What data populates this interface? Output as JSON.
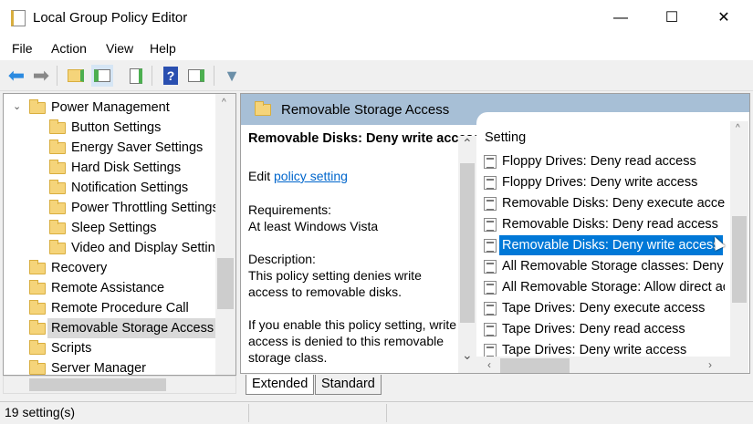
{
  "window": {
    "title": "Local Group Policy Editor",
    "minimize": "—",
    "maximize": "☐",
    "close": "✕"
  },
  "menu": [
    "File",
    "Action",
    "View",
    "Help"
  ],
  "toolbar": [
    "back-icon",
    "forward-icon",
    "up-folder-icon",
    "show-hide-tree-icon",
    "export-list-icon",
    "help-icon",
    "show-hide-action-pane-icon",
    "filter-icon"
  ],
  "tree": [
    {
      "label": "Power Management",
      "level": 0,
      "expanded": true
    },
    {
      "label": "Button Settings",
      "level": 1
    },
    {
      "label": "Energy Saver Settings",
      "level": 1
    },
    {
      "label": "Hard Disk Settings",
      "level": 1
    },
    {
      "label": "Notification Settings",
      "level": 1
    },
    {
      "label": "Power Throttling Settings",
      "level": 1
    },
    {
      "label": "Sleep Settings",
      "level": 1
    },
    {
      "label": "Video and Display Settings",
      "level": 1
    },
    {
      "label": "Recovery",
      "level": 0
    },
    {
      "label": "Remote Assistance",
      "level": 0
    },
    {
      "label": "Remote Procedure Call",
      "level": 0
    },
    {
      "label": "Removable Storage Access",
      "level": 0,
      "selected": true
    },
    {
      "label": "Scripts",
      "level": 0
    },
    {
      "label": "Server Manager",
      "level": 0
    }
  ],
  "pane": {
    "header": "Removable Storage Access",
    "desc": {
      "title": "Removable Disks: Deny write access",
      "edit_prefix": "Edit",
      "edit_link": "policy setting",
      "req_label": "Requirements:",
      "req_value": "At least Windows Vista",
      "desc_label": "Description:",
      "desc_text": "This policy setting denies write access to removable disks.",
      "desc_more": "If you enable this policy setting, write access is denied to this removable storage class."
    },
    "column": "Setting",
    "items": [
      "Floppy Drives: Deny read access",
      "Floppy Drives: Deny write access",
      "Removable Disks: Deny execute access",
      "Removable Disks: Deny read access",
      "Removable Disks: Deny write access",
      "All Removable Storage classes: Deny all access",
      "All Removable Storage: Allow direct access in remote sessions",
      "Tape Drives: Deny execute access",
      "Tape Drives: Deny read access",
      "Tape Drives: Deny write access"
    ],
    "selected_index": 4
  },
  "tabs": [
    "Extended",
    "Standard"
  ],
  "status": "19 setting(s)",
  "colors": {
    "selection": "#0078d7",
    "header": "#a7bfd6",
    "link": "#0066cc"
  }
}
